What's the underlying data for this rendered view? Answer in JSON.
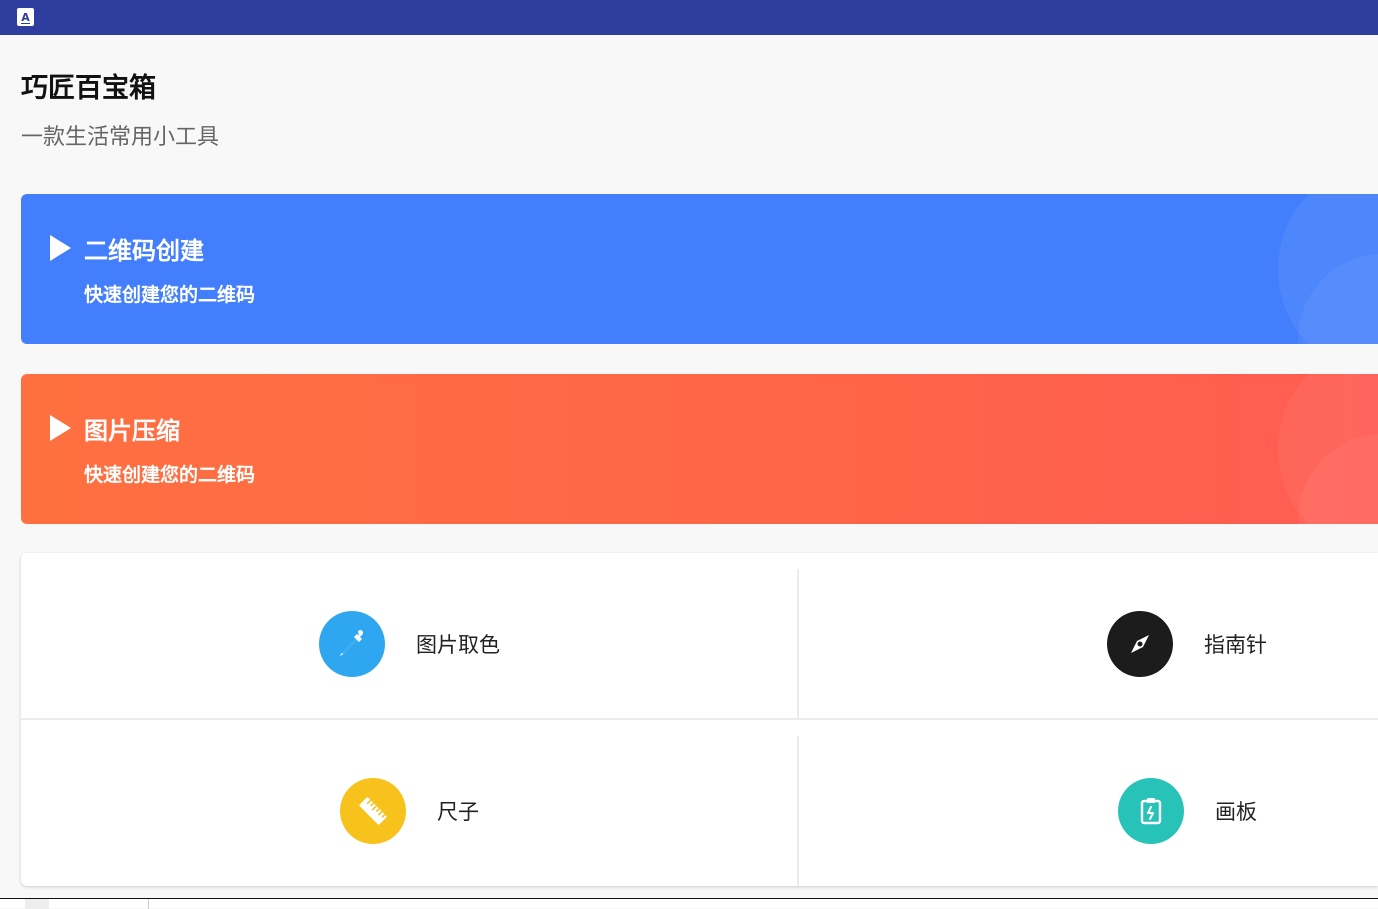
{
  "window": {
    "app_icon_glyph": "A"
  },
  "header": {
    "title": "巧匠百宝箱",
    "subtitle": "一款生活常用小工具"
  },
  "banners": [
    {
      "title": "二维码创建",
      "description": "快速创建您的二维码",
      "color": "#437ffc"
    },
    {
      "title": "图片压缩",
      "description": "快速创建您的二维码",
      "color": "#ff6a45"
    }
  ],
  "tools": [
    {
      "label": "图片取色",
      "icon": "eyedropper-icon",
      "color": "#2fa7f0"
    },
    {
      "label": "指南针",
      "icon": "compass-icon",
      "color": "#1c1c1c"
    },
    {
      "label": "尺子",
      "icon": "ruler-icon",
      "color": "#f7c21b"
    },
    {
      "label": "画板",
      "icon": "clipboard-icon",
      "color": "#27c2b8"
    }
  ]
}
